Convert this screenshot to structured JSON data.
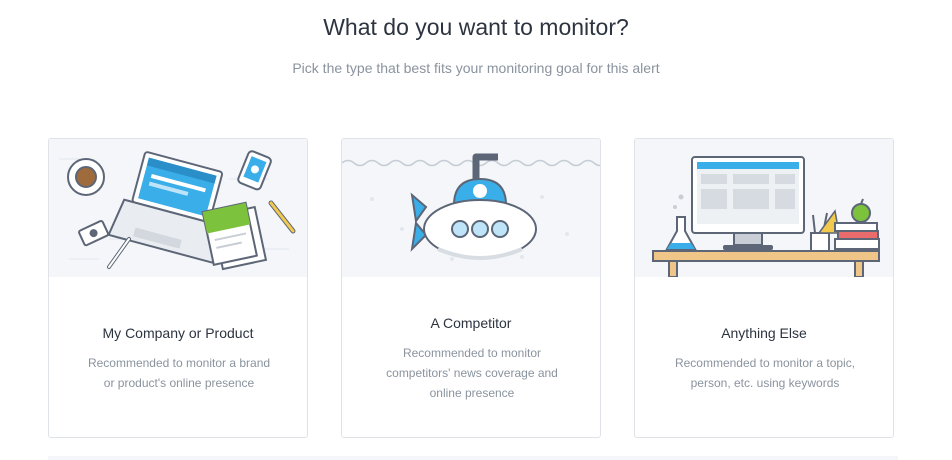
{
  "header": {
    "title": "What do you want to monitor?",
    "subtitle": "Pick the type that best fits your monitoring goal for this alert"
  },
  "cards": [
    {
      "title": "My Company or Product",
      "description": "Recommended to monitor a brand or product's online presence",
      "illustration": "laptop-desk-illustration"
    },
    {
      "title": "A Competitor",
      "description": "Recommended to monitor competitors' news coverage and online presence",
      "illustration": "submarine-illustration"
    },
    {
      "title": "Anything Else",
      "description": "Recommended to monitor a topic, person, etc. using keywords",
      "illustration": "desktop-computer-illustration"
    }
  ],
  "colors": {
    "accent_blue": "#3aaee8",
    "accent_green": "#7dc23c",
    "illustration_bg": "#f4f6f9",
    "outline": "#5d6677"
  }
}
